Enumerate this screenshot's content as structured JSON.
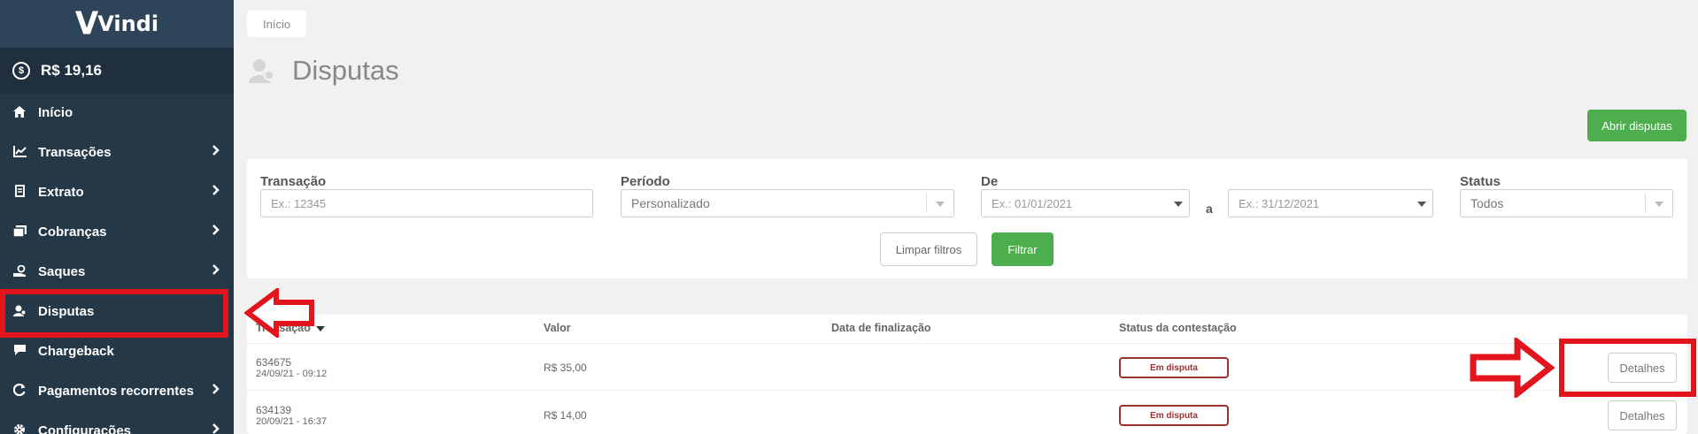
{
  "brand": {
    "name": "Vindi",
    "mark": "V"
  },
  "balance": "R$ 19,16",
  "sidebar": {
    "items": [
      {
        "label": "Início",
        "icon": "home-icon",
        "glyph": "⌂",
        "chevron": false
      },
      {
        "label": "Transações",
        "icon": "chart-line-icon",
        "glyph": "📈",
        "chevron": true
      },
      {
        "label": "Extrato",
        "icon": "document-icon",
        "glyph": "▤",
        "chevron": true
      },
      {
        "label": "Cobranças",
        "icon": "invoice-icon",
        "glyph": "▦",
        "chevron": true
      },
      {
        "label": "Saques",
        "icon": "withdraw-icon",
        "glyph": "⊜",
        "chevron": true
      },
      {
        "label": "Disputas",
        "icon": "user-dispute-icon",
        "glyph": "👤",
        "chevron": false
      },
      {
        "label": "Chargeback",
        "icon": "chat-bubble-icon",
        "glyph": "💬",
        "chevron": false
      },
      {
        "label": "Pagamentos recorrentes",
        "icon": "refresh-icon",
        "glyph": "↻",
        "chevron": true
      },
      {
        "label": "Configurações",
        "icon": "gear-icon",
        "glyph": "⚙",
        "chevron": true
      }
    ]
  },
  "breadcrumb": "Início",
  "page": {
    "title": "Disputas",
    "open_button": "Abrir disputas"
  },
  "filters": {
    "transaction_label": "Transação",
    "transaction_placeholder": "Ex.: 12345",
    "period_label": "Período",
    "period_value": "Personalizado",
    "from_label": "De",
    "from_placeholder": "Ex.: 01/01/2021",
    "range_separator": "a",
    "to_placeholder": "Ex.: 31/12/2021",
    "status_label": "Status",
    "status_value": "Todos",
    "clear_button": "Limpar filtros",
    "filter_button": "Filtrar"
  },
  "table": {
    "headers": [
      "Transação",
      "Valor",
      "Data de finalização",
      "Status da contestação"
    ],
    "rows": [
      {
        "id": "634675",
        "date": "24/09/21 - 09:12",
        "value": "R$ 35,00",
        "end_date": "",
        "status": "Em disputa",
        "action": "Detalhes"
      },
      {
        "id": "634139",
        "date": "20/09/21 - 16:37",
        "value": "R$ 14,00",
        "end_date": "",
        "status": "Em disputa",
        "action": "Detalhes"
      }
    ]
  },
  "colors": {
    "sidebar_bg": "#253847",
    "logo_bg": "#2e4458",
    "balance_bg": "#1f2f3d",
    "page_bg": "#f1f1f1",
    "primary_green": "#4cae4c",
    "status_red": "#9b3030",
    "annotation_red": "#e3141c"
  }
}
